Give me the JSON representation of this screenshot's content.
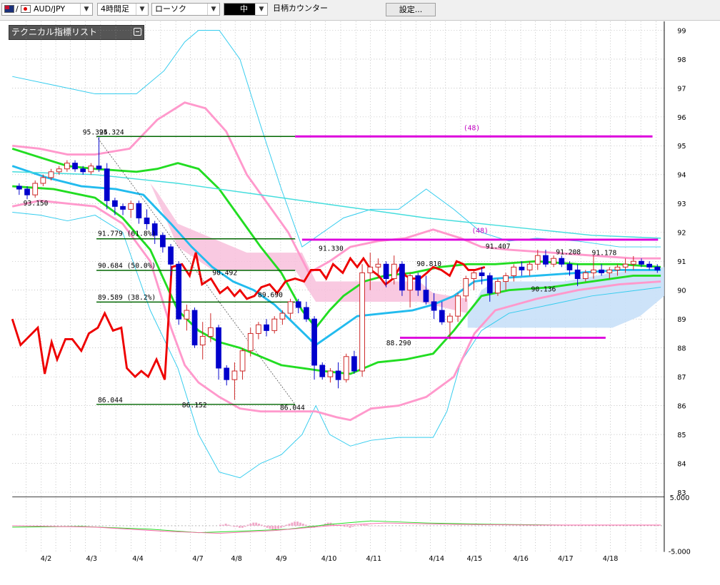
{
  "toolbar": {
    "symbol": "AUD/JPY",
    "timeframe": "4時間足",
    "chart_type": "ローソク",
    "size": "中",
    "counter_label": "日柄カウンター",
    "settings": "設定...",
    "dropdown_icon": "chevron-down-icon",
    "colors": {
      "toolbar_bg": "#f0f0f0"
    }
  },
  "indicator_list": {
    "label": "テクニカル指標リスト",
    "icon": "minimize-icon"
  },
  "price_axis": [
    "99",
    "98",
    "97",
    "96",
    "95",
    "94",
    "93",
    "92",
    "91",
    "90",
    "89",
    "88",
    "87",
    "86",
    "85",
    "84",
    "83"
  ],
  "osc_axis": {
    "top": "5.000",
    "bottom": "-5.000"
  },
  "date_axis": [
    "4/2",
    "4/3",
    "4/4",
    "4/7",
    "4/8",
    "4/9",
    "4/10",
    "4/11",
    "4/14",
    "4/15",
    "4/16",
    "4/17",
    "4/18"
  ],
  "annotations": {
    "high_a": "95.324",
    "high_b": "95.324",
    "low_left": "93.150",
    "fib_618": "91.779 (61.8%)",
    "fib_500": "90.684 (50.0%)",
    "fib_382": "89.589 (38.2%)",
    "fib_low": "86.044",
    "low_a": "86.152",
    "low_b": "86.044",
    "val_90492": "90.492",
    "val_89690": "89.690",
    "val_91330": "91.330",
    "val_88290": "88.290",
    "val_90810": "90.810",
    "val_91407": "91.407",
    "val_90136": "90.136",
    "val_91208": "91.208",
    "val_91178": "91.178",
    "count_a": "(48)",
    "count_b": "(48)"
  },
  "colors": {
    "bull": "#cc2222",
    "bear": "#0000cc",
    "bb_inner": "#ff99cc",
    "bb_outer": "#33ccee",
    "ma_green": "#22dd22",
    "ma_blue": "#22bbee",
    "ma_cyan": "#44dddd",
    "osc_red": "#ee0000",
    "fib": "#006600",
    "counter": "#dd00dd",
    "cloud_pink": "#f8c0dc",
    "cloud_blue": "#c8e0f8",
    "grid": "#999999"
  },
  "chart_data": {
    "type": "candlestick",
    "symbol": "AUD/JPY",
    "timeframe": "4時間足",
    "ylim": [
      83,
      99
    ],
    "x_ticks": [
      "4/2",
      "4/3",
      "4/4",
      "4/7",
      "4/8",
      "4/9",
      "4/10",
      "4/11",
      "4/14",
      "4/15",
      "4/16",
      "4/17",
      "4/18"
    ],
    "candles": [
      [
        93.6,
        93.7,
        93.3,
        93.5
      ],
      [
        93.5,
        93.6,
        93.15,
        93.3
      ],
      [
        93.3,
        93.8,
        93.2,
        93.7
      ],
      [
        93.7,
        94.0,
        93.6,
        93.9
      ],
      [
        93.9,
        94.2,
        93.8,
        94.1
      ],
      [
        94.1,
        94.3,
        94.0,
        94.2
      ],
      [
        94.2,
        94.5,
        94.1,
        94.4
      ],
      [
        94.4,
        94.5,
        94.1,
        94.2
      ],
      [
        94.2,
        94.3,
        94.0,
        94.1
      ],
      [
        94.1,
        94.4,
        94.0,
        94.3
      ],
      [
        94.3,
        95.3,
        94.1,
        94.2
      ],
      [
        94.2,
        94.4,
        92.8,
        93.1
      ],
      [
        93.1,
        93.2,
        92.6,
        92.9
      ],
      [
        92.9,
        93.0,
        92.6,
        92.8
      ],
      [
        92.8,
        93.1,
        92.5,
        93.0
      ],
      [
        93.0,
        93.1,
        92.3,
        92.5
      ],
      [
        92.5,
        92.8,
        92.1,
        92.3
      ],
      [
        92.3,
        92.4,
        91.6,
        91.9
      ],
      [
        91.9,
        92.0,
        91.3,
        91.5
      ],
      [
        91.5,
        91.6,
        90.5,
        90.9
      ],
      [
        90.9,
        91.0,
        88.8,
        89.0
      ],
      [
        89.0,
        89.5,
        88.6,
        89.3
      ],
      [
        89.3,
        89.4,
        88.0,
        88.1
      ],
      [
        88.1,
        88.9,
        87.6,
        88.4
      ],
      [
        88.4,
        89.2,
        88.2,
        88.7
      ],
      [
        88.7,
        88.8,
        86.9,
        87.3
      ],
      [
        87.3,
        87.4,
        86.7,
        86.9
      ],
      [
        86.9,
        87.5,
        86.2,
        87.2
      ],
      [
        87.2,
        88.0,
        86.9,
        87.9
      ],
      [
        87.9,
        88.7,
        87.7,
        88.5
      ],
      [
        88.5,
        88.9,
        88.3,
        88.8
      ],
      [
        88.8,
        89.0,
        88.4,
        88.6
      ],
      [
        88.6,
        89.1,
        88.5,
        89.0
      ],
      [
        89.0,
        89.3,
        88.8,
        89.2
      ],
      [
        89.2,
        89.7,
        89.0,
        89.6
      ],
      [
        89.6,
        89.7,
        89.2,
        89.4
      ],
      [
        89.4,
        89.6,
        88.9,
        89.0
      ],
      [
        89.0,
        89.1,
        86.9,
        87.4
      ],
      [
        87.4,
        87.5,
        86.9,
        87.0
      ],
      [
        87.0,
        87.3,
        86.8,
        87.2
      ],
      [
        87.2,
        87.5,
        86.6,
        86.9
      ],
      [
        86.9,
        87.8,
        86.8,
        87.7
      ],
      [
        87.7,
        87.9,
        87.1,
        87.2
      ],
      [
        87.2,
        90.9,
        87.0,
        90.6
      ],
      [
        90.6,
        91.3,
        90.0,
        90.8
      ],
      [
        90.8,
        91.1,
        90.4,
        90.9
      ],
      [
        90.9,
        91.0,
        90.1,
        90.4
      ],
      [
        90.4,
        91.2,
        90.2,
        90.9
      ],
      [
        90.9,
        91.0,
        89.8,
        90.0
      ],
      [
        90.0,
        90.6,
        89.4,
        90.5
      ],
      [
        90.5,
        90.6,
        89.8,
        90.0
      ],
      [
        90.0,
        90.5,
        89.5,
        89.6
      ],
      [
        89.6,
        89.9,
        89.0,
        89.3
      ],
      [
        89.3,
        89.6,
        88.8,
        88.9
      ],
      [
        88.9,
        89.2,
        88.3,
        89.1
      ],
      [
        89.1,
        89.9,
        88.9,
        89.8
      ],
      [
        89.8,
        90.5,
        89.6,
        90.4
      ],
      [
        90.4,
        90.7,
        90.0,
        90.6
      ],
      [
        90.6,
        90.8,
        90.2,
        90.5
      ],
      [
        90.5,
        90.6,
        89.6,
        89.9
      ],
      [
        89.9,
        90.4,
        89.8,
        90.3
      ],
      [
        90.3,
        90.6,
        90.0,
        90.5
      ],
      [
        90.5,
        90.9,
        90.3,
        90.8
      ],
      [
        90.8,
        91.0,
        90.5,
        90.7
      ],
      [
        90.7,
        91.0,
        90.5,
        90.9
      ],
      [
        90.9,
        91.4,
        90.7,
        91.2
      ],
      [
        91.2,
        91.4,
        90.8,
        90.9
      ],
      [
        90.9,
        91.2,
        90.8,
        91.1
      ],
      [
        91.1,
        91.2,
        90.8,
        90.9
      ],
      [
        90.9,
        91.0,
        90.5,
        90.7
      ],
      [
        90.7,
        90.9,
        90.14,
        90.4
      ],
      [
        90.4,
        90.7,
        90.3,
        90.6
      ],
      [
        90.6,
        91.2,
        90.4,
        90.7
      ],
      [
        90.7,
        90.9,
        90.5,
        90.6
      ],
      [
        90.6,
        90.8,
        90.4,
        90.7
      ],
      [
        90.7,
        90.9,
        90.5,
        90.8
      ],
      [
        90.8,
        91.1,
        90.6,
        90.9
      ],
      [
        90.9,
        91.18,
        90.7,
        91.0
      ],
      [
        91.0,
        91.1,
        90.8,
        90.9
      ],
      [
        90.9,
        91.0,
        90.7,
        90.8
      ],
      [
        90.8,
        90.9,
        90.6,
        90.7
      ]
    ],
    "fibonacci": [
      {
        "label": "95.324",
        "y": 95.324
      },
      {
        "label": "91.779 (61.8%)",
        "y": 91.779
      },
      {
        "label": "90.684 (50.0%)",
        "y": 90.684
      },
      {
        "label": "89.589 (38.2%)",
        "y": 89.589
      },
      {
        "label": "86.044",
        "y": 86.044
      }
    ]
  }
}
